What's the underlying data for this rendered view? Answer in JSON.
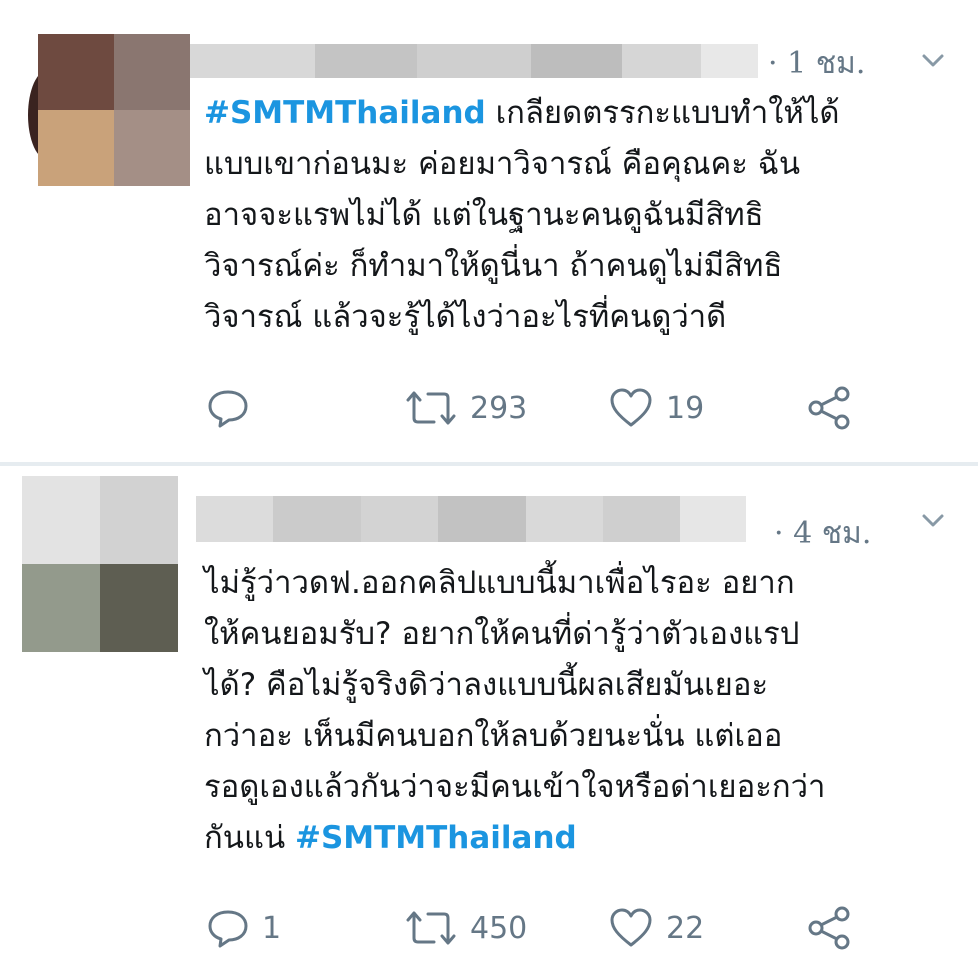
{
  "tweets": [
    {
      "time": "· 1 ชม.",
      "text_prefix": "",
      "hashtag_start": "#SMTMThailand",
      "text": " เกลียดตรรกะแบบทำให้ได้\nแบบเขาก่อนมะ ค่อยมาวิจารณ์ คือคุณคะ ฉัน\nอาจจะแรพไม่ได้ แต่ในฐานะคนดูฉันมีสิทธิ\nวิจารณ์ค่ะ ก็ทำมาให้ดูนี่นา ถ้าคนดูไม่มีสิทธิ\nวิจารณ์ แล้วจะรู้ได้ไงว่าอะไรที่คนดูว่าดี",
      "reply_count": "",
      "retweet_count": "293",
      "like_count": "19"
    },
    {
      "time": "· 4 ชม.",
      "text": "ไม่รู้ว่าวดฟ.ออกคลิปแบบนี้มาเพื่อไรอะ อยาก\nให้คนยอมรับ? อยากให้คนที่ด่ารู้ว่าตัวเองแรป\nได้? คือไม่รู้จริงดิว่าลงแบบนี้ผลเสียมันเยอะ\nกว่าอะ เห็นมีคนบอกให้ลบด้วยนะนั่น แต่เออ\nรอดูเองแล้วกันว่าจะมีคนเข้าใจหรือด่าเยอะกว่า\nกันแน่ ",
      "hashtag_end": "#SMTMThailand",
      "reply_count": "1",
      "retweet_count": "450",
      "like_count": "22"
    }
  ],
  "colors": {
    "hashtag": "#1b95e0",
    "meta": "#657786",
    "text": "#14171a",
    "divider": "#e6ecf0"
  },
  "icons": [
    "reply-icon",
    "retweet-icon",
    "like-icon",
    "share-icon",
    "chevron-down-icon"
  ]
}
